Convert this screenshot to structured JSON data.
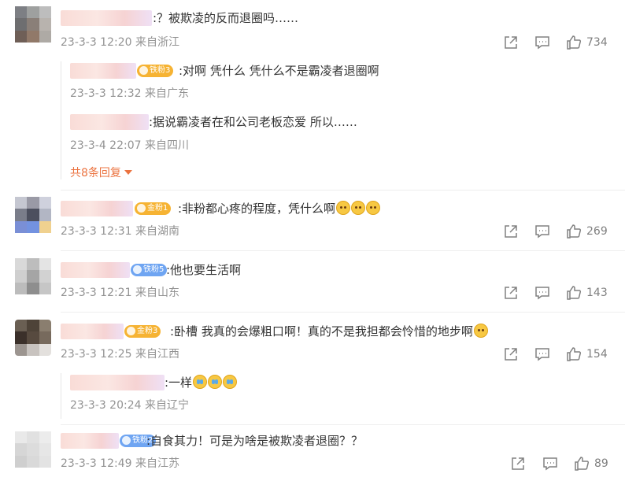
{
  "comments": [
    {
      "text": ":？被欺凌的反而退圈吗……",
      "time": "23-3-3 12:20",
      "location": "来自浙江",
      "likes": "734",
      "replies": [
        {
          "badge": "铁粉3",
          "text": ":对啊 凭什么 凭什么不是霸凌者退圈啊",
          "time": "23-3-3 12:32",
          "location": "来自广东"
        },
        {
          "badge": "",
          "text": ":据说霸凌者在和公司老板恋爱 所以……",
          "time": "23-3-4 22:07",
          "location": "来自四川"
        }
      ],
      "more_replies": "共8条回复"
    },
    {
      "badge": "金粉1",
      "text": ":非粉都心疼的程度，凭什么啊",
      "emojis": [
        "face",
        "face",
        "face"
      ],
      "time": "23-3-3 12:31",
      "location": "来自湖南",
      "likes": "269"
    },
    {
      "badge": "铁粉5",
      "text": ":他也要生活啊",
      "time": "23-3-3 12:21",
      "location": "来自山东",
      "likes": "143"
    },
    {
      "badge": "金粉3",
      "text": ":卧槽 我真的会爆粗口啊！真的不是我担都会怜惜的地步啊",
      "emojis": [
        "face"
      ],
      "time": "23-3-3 12:25",
      "location": "来自江西",
      "likes": "154",
      "replies": [
        {
          "badge": "",
          "text": ":一样",
          "emojis": [
            "cry",
            "cry",
            "cry"
          ],
          "time": "23-3-3 20:24",
          "location": "来自辽宁"
        }
      ]
    },
    {
      "badge": "铁粉2",
      "text": ":自食其力！可是为啥是被欺凌者退圈？？",
      "time": "23-3-3 12:49",
      "location": "来自江苏",
      "likes": "89"
    }
  ],
  "icons": {
    "share": "share-icon",
    "comment": "comment-icon",
    "like": "thumbs-up-icon"
  },
  "colors": {
    "link_orange": "#eb7340",
    "meta_gray": "#939393",
    "badge_blue": "#6fa5f2",
    "badge_gold": "#f6b333"
  }
}
